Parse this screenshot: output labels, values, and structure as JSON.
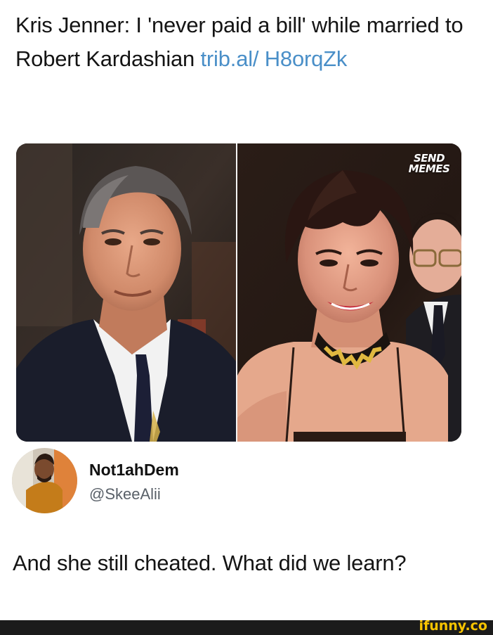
{
  "tweet": {
    "text_before_link": "Kris Jenner: I 'never paid a bill' while married to Robert Kardashian ",
    "link_text": "trib.al/ H8orqZk",
    "link_color": "#4a8fc8"
  },
  "photo": {
    "watermark_line1": "SEND",
    "watermark_line2": "MEMES"
  },
  "reply": {
    "display_name": "Not1ahDem",
    "handle": "@SkeeAlii",
    "text": "And she still cheated. What did we learn?"
  },
  "footer": {
    "logo_text": "ifunny.co",
    "bar_color": "#1b1b1b",
    "logo_color": "#f8c400"
  }
}
